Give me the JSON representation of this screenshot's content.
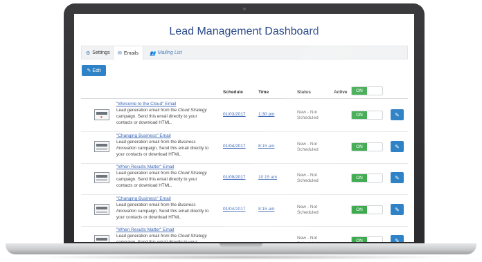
{
  "page": {
    "title": "Lead Management Dashboard"
  },
  "tabs": [
    {
      "label": "Settings",
      "icon": "gear-icon"
    },
    {
      "label": "Emails",
      "icon": "mail-icon"
    },
    {
      "label": "Mailing List",
      "icon": "users-icon"
    }
  ],
  "toolbar": {
    "edit_label": "Edit",
    "edit_icon": "pencil-icon"
  },
  "table": {
    "headers": {
      "schedule": "Schedule",
      "time": "Time",
      "status": "Status",
      "active": "Active"
    },
    "master_toggle": "ON",
    "rows": [
      {
        "title": "\"Welcome to the Cloud\" Email",
        "desc_pre": "Lead generation email from the ",
        "desc_em": "Cloud Strategy",
        "desc_post": " campaign. Send this email directly to your contacts or download HTML.",
        "schedule": "01/03/2017",
        "time": "1:30 pm",
        "status": "New - Not Scheduled",
        "toggle": "ON",
        "thumb": "heart"
      },
      {
        "title": "\"Changing Business\" Email",
        "desc_pre": "Lead generation email from the ",
        "desc_em": "Business Innovation",
        "desc_post": " campaign. Send this email directly to your contacts or download HTML.",
        "schedule": "01/04/2017",
        "time": "8:15 am",
        "status": "New - Not Scheduled",
        "toggle": "ON",
        "thumb": "plain"
      },
      {
        "title": "\"When Results Matter\" Email",
        "desc_pre": "Lead generation email from the ",
        "desc_em": "Cloud Strategy",
        "desc_post": " campaign. Send this email directly to your contacts or download HTML.",
        "schedule": "01/09/2017",
        "time": "10:15 am",
        "status": "New - Not Scheduled",
        "toggle": "ON",
        "thumb": "plain"
      },
      {
        "title": "\"Changing Business\" Email",
        "desc_pre": "Lead generation email from the ",
        "desc_em": "Business Innovation",
        "desc_post": " campaign. Send this email directly to your contacts or download HTML.",
        "schedule": "01/04/2017",
        "time": "8:15 am",
        "status": "New - Not Scheduled",
        "toggle": "ON",
        "thumb": "plain"
      },
      {
        "title": "\"When Results Matter\" Email",
        "desc_pre": "Lead generation email from the ",
        "desc_em": "Cloud Strategy",
        "desc_post": " campaign. Send this email directly to your contacts or download HTML.",
        "schedule": "",
        "time": "",
        "status": "New - Not Scheduled",
        "toggle": "ON",
        "thumb": "plain"
      }
    ]
  },
  "colors": {
    "accent": "#2f82c6",
    "toggle_on": "#3daa4e",
    "title": "#2b4a8a",
    "link": "#3c66b4"
  }
}
